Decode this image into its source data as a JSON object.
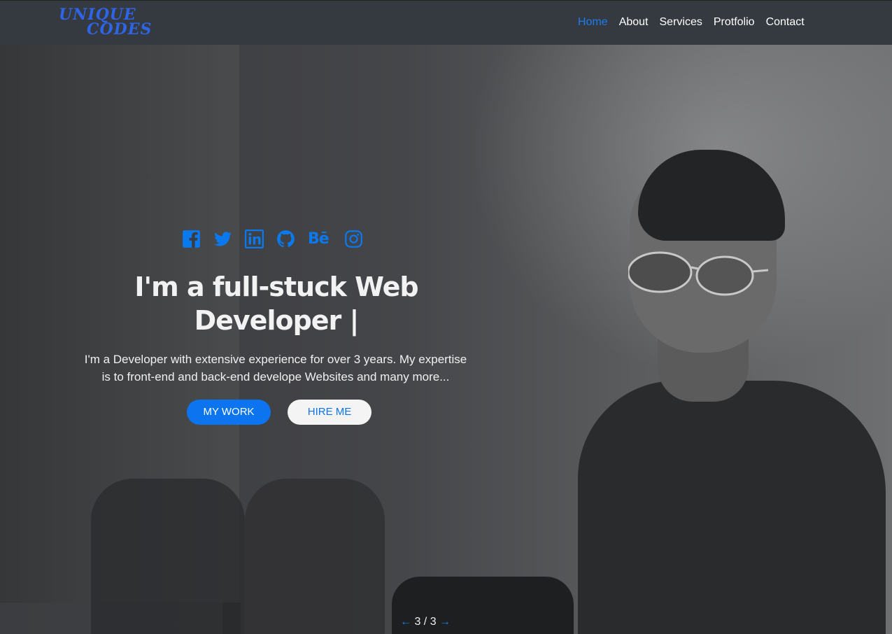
{
  "brand": {
    "line1": "UNIQUE",
    "line2": "CODES",
    "color": "#2f64e6"
  },
  "nav": {
    "items": [
      {
        "label": "Home",
        "active": true
      },
      {
        "label": "About",
        "active": false
      },
      {
        "label": "Services",
        "active": false
      },
      {
        "label": "Protfolio",
        "active": false
      },
      {
        "label": "Contact",
        "active": false
      }
    ],
    "active_color": "#1e7bf0"
  },
  "hero": {
    "social_icons": [
      "facebook-icon",
      "twitter-icon",
      "linkedin-icon",
      "github-icon",
      "behance-icon",
      "instagram-icon"
    ],
    "behance_text": "Bē",
    "headline_line1": "I'm a full-stuck Web",
    "headline_line2": "Developer |",
    "description_line1": "I'm a Developer with extensive experience for over 3 years. My expertise",
    "description_line2": "is to front-end and back-end develope Websites and many more...",
    "primary_button": "MY WORK",
    "secondary_button": "HIRE ME",
    "accent_color": "#0b74ee"
  },
  "slider": {
    "prev": "←",
    "counter": "3 / 3",
    "next": "→"
  }
}
